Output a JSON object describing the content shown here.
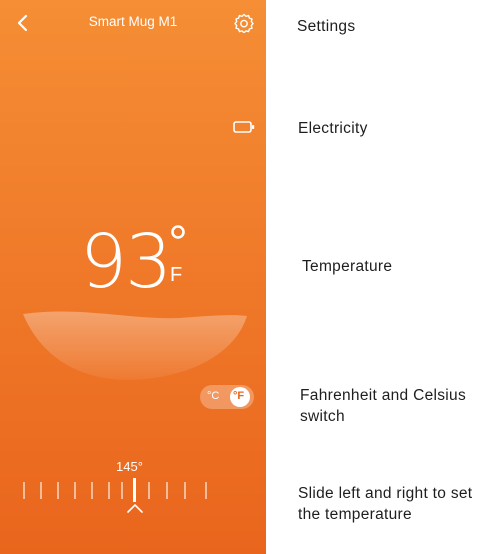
{
  "header": {
    "title": "Smart Mug M1",
    "back_icon": "chevron-left-icon",
    "settings_icon": "gear-icon"
  },
  "battery_icon": "battery-icon",
  "temperature": {
    "value": "93",
    "unit": "F"
  },
  "unit_switch": {
    "celsius_label": "°C",
    "fahrenheit_label": "°F",
    "selected": "°F"
  },
  "slider": {
    "set_value": "145°"
  },
  "callouts": {
    "settings": "Settings",
    "electricity": "Electricity",
    "temperature": "Temperature",
    "unit_switch": "Fahrenheit and Celsius switch",
    "slider": "Slide left and right to set the temperature"
  },
  "colors": {
    "gradient_top": "#f58e35",
    "gradient_bottom": "#e9651d",
    "text": "#ffffff"
  }
}
